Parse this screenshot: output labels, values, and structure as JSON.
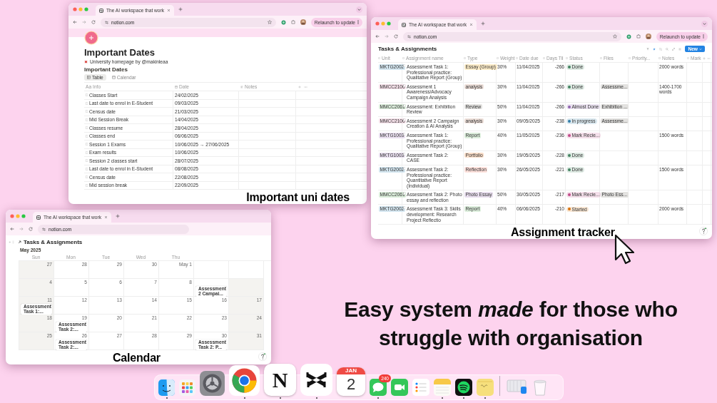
{
  "windows": [
    {
      "kind": "calendar",
      "tab_title": "The AI workspace that work",
      "url": "notion.com",
      "page_title": "Tasks & Assignments",
      "month": "May 2025",
      "weekdays": [
        "Sun",
        "Mon",
        "Tue",
        "Wed",
        "Thu"
      ],
      "weeks": [
        [
          {
            "number": "27",
            "shaded": true
          },
          {
            "number": "28",
            "shaded": false
          },
          {
            "number": "29",
            "shaded": false
          },
          {
            "number": "30",
            "shaded": false
          },
          {
            "number": "May 1",
            "shaded": false
          }
        ],
        [
          {
            "number": "4",
            "shaded": true
          },
          {
            "number": "5",
            "shaded": false
          },
          {
            "number": "6",
            "shaded": false
          },
          {
            "number": "7",
            "shaded": false
          },
          {
            "number": "8",
            "shaded": false
          },
          {
            "shaded": false,
            "events": [
              "Assessment 2 Campai..."
            ]
          },
          {
            "shaded": true
          }
        ],
        [
          {
            "number": "11",
            "shaded": true,
            "events": [
              "Assessment Task 1:..."
            ]
          },
          {
            "number": "12",
            "shaded": false
          },
          {
            "number": "13",
            "shaded": false
          },
          {
            "number": "14",
            "shaded": false
          },
          {
            "number": "15",
            "shaded": false
          },
          {
            "number": "16",
            "shaded": false
          },
          {
            "number": "17",
            "shaded": true
          }
        ],
        [
          {
            "number": "18",
            "shaded": true
          },
          {
            "number": "19",
            "shaded": false,
            "events": [
              "Assessment Task 2:..."
            ]
          },
          {
            "number": "20",
            "shaded": false
          },
          {
            "number": "21",
            "shaded": false
          },
          {
            "number": "22",
            "shaded": false
          },
          {
            "number": "23",
            "shaded": false
          },
          {
            "number": "24",
            "shaded": true
          }
        ],
        [
          {
            "number": "25",
            "shaded": true
          },
          {
            "number": "26",
            "shaded": false,
            "events": [
              "Assessment Task 2:..."
            ]
          },
          {
            "number": "27",
            "shaded": false
          },
          {
            "number": "28",
            "shaded": false
          },
          {
            "number": "29",
            "shaded": false
          },
          {
            "number": "30",
            "shaded": false,
            "events": [
              "Assessment Task 2: P..."
            ]
          },
          {
            "number": "31",
            "shaded": true
          }
        ]
      ],
      "caption": "Calendar"
    },
    {
      "kind": "table",
      "tab_title": "The AI workspace that work",
      "url": "notion.com",
      "relaunch": "Relaunch to update",
      "title": "Important Dates",
      "subtitle": "University homepage by @makinleaa",
      "database_title": "Important Dates",
      "views": [
        {
          "label": "Table",
          "selected": true
        },
        {
          "label": "Calendar",
          "selected": false
        }
      ],
      "columns": [
        {
          "glyph": "Aa",
          "label": "Info"
        },
        {
          "label": "Date"
        },
        {
          "label": "Notes"
        }
      ],
      "rows": [
        {
          "info": "Classes Start",
          "date": "24/02/2025"
        },
        {
          "info": "Last date to enrol in E-Student",
          "date": "09/03/2025"
        },
        {
          "info": "Census date",
          "date": "21/03/2025"
        },
        {
          "info": "Mid Session Break",
          "date": "14/04/2025"
        },
        {
          "info": "Classes resume",
          "date": "28/04/2025"
        },
        {
          "info": "Classes end",
          "date": "06/06/2025"
        },
        {
          "info": "Session 1 Exams",
          "date": "10/06/2025 → 27/06/2025"
        },
        {
          "info": "Exam results",
          "date": "10/06/2025"
        },
        {
          "info": "Session 2 classes start",
          "date": "28/07/2025"
        },
        {
          "info": "Last date to enrol in E-Student",
          "date": "08/08/2025"
        },
        {
          "info": "Census date",
          "date": "22/08/2025"
        },
        {
          "info": "Mid session break",
          "date": "22/09/2025"
        }
      ],
      "caption": "Important uni dates"
    },
    {
      "kind": "tracker",
      "tab_title": "The AI workspace that work",
      "url": "notion.com",
      "relaunch": "Relaunch to update",
      "title": "Tasks & Assignments",
      "new_button": "New",
      "columns": [
        "Unit",
        "Assignment name",
        "Type",
        "Weight",
        "Date due",
        "Days Til",
        "Status",
        "Files",
        "Priority...",
        "Notes",
        "Mark"
      ],
      "rows": [
        {
          "unit": {
            "text": "MKTG2002",
            "color": "#d3e5ef"
          },
          "name": "Assessment Task 1: Professional practice: Qualitative Report (Group)",
          "type": {
            "text": "Essay (Group)",
            "color": "#fdecc8"
          },
          "weight": "30%",
          "due": "11/04/2025",
          "days": "-266",
          "status": {
            "text": "Done",
            "color": "#448361"
          },
          "notes": "2000 words"
        },
        {
          "unit": {
            "text": "MMCC2100",
            "color": "#f5e0e9"
          },
          "name": "Assessment 1 Awareness/Advocacy Campaign Analysis",
          "type": {
            "text": "analysis",
            "color": "#eee0da"
          },
          "weight": "30%",
          "due": "11/04/2025",
          "days": "-266",
          "status": {
            "text": "Done",
            "color": "#448361"
          },
          "files": "Assessme...",
          "notes": "1400-1700 words"
        },
        {
          "unit": {
            "text": "MMCC2061",
            "color": "#dbeddb"
          },
          "name": "Assessment: Exhibition Review",
          "type": {
            "text": "Review",
            "color": "#e3e2e0"
          },
          "weight": "50%",
          "due": "11/04/2025",
          "days": "-266",
          "status": {
            "text": "Almost Done",
            "color": "#9065b0"
          },
          "files": "Exhibition ..."
        },
        {
          "unit": {
            "text": "MMCC2100",
            "color": "#f5e0e9"
          },
          "name": "Assessment 2 Campaign Creation & AI Analysis",
          "type": {
            "text": "analysis",
            "color": "#eee0da"
          },
          "weight": "30%",
          "due": "09/05/2025",
          "days": "-238",
          "status": {
            "text": "In progress",
            "color": "#337ea9"
          },
          "files": "Assessme..."
        },
        {
          "unit": {
            "text": "MKTG1003",
            "color": "#e8deee"
          },
          "name": "Assessment Task 1: Professional practice: Qualitative Report (Group)",
          "type": {
            "text": "Report",
            "color": "#dbeddb"
          },
          "weight": "40%",
          "due": "11/05/2025",
          "days": "-236",
          "status": {
            "text": "Mark Recie...",
            "color": "#c14c8a"
          },
          "notes": "1500 words"
        },
        {
          "unit": {
            "text": "MKTG1003",
            "color": "#e8deee"
          },
          "name": "Assessment Task 2: CASE",
          "type": {
            "text": "Portfolio",
            "color": "#fadec9"
          },
          "weight": "30%",
          "due": "19/05/2025",
          "days": "-228",
          "status": {
            "text": "Done",
            "color": "#448361"
          }
        },
        {
          "unit": {
            "text": "MKTG2002",
            "color": "#d3e5ef"
          },
          "name": "Assessment Task 2: Professional practice: Quantitative Report (Individual)",
          "type": {
            "text": "Reflection",
            "color": "#ffe2dd"
          },
          "weight": "30%",
          "due": "26/05/2025",
          "days": "-221",
          "status": {
            "text": "Done",
            "color": "#448361"
          },
          "notes": "1500 words"
        },
        {
          "unit": {
            "text": "MMCC2061",
            "color": "#dbeddb"
          },
          "name": "Assessment Task 2: Photo essay and reflection",
          "type": {
            "text": "Photo Essay",
            "color": "#e8deee"
          },
          "weight": "50%",
          "due": "30/05/2025",
          "days": "-217",
          "status": {
            "text": "Mark Recie...",
            "color": "#c14c8a"
          },
          "files": "Photo Ess..."
        },
        {
          "unit": {
            "text": "MKTG2002",
            "color": "#d3e5ef"
          },
          "name": "Assessment Task 3: Skills development: Research Project Reflectio",
          "type": {
            "text": "Report",
            "color": "#dbeddb"
          },
          "weight": "40%",
          "due": "06/06/2025",
          "days": "-210",
          "status": {
            "text": "Started",
            "color": "#d9730d"
          },
          "notes": "2000 words"
        }
      ],
      "caption": "Assignment tracker"
    }
  ],
  "headline": "Easy system *made* for those who struggle with organisation",
  "dock": [
    {
      "kind": "finder",
      "running": true
    },
    {
      "kind": "launchpad",
      "running": false
    },
    {
      "kind": "settings",
      "running": false
    },
    {
      "kind": "chrome",
      "running": true
    },
    {
      "kind": "notion",
      "glyph": "N",
      "running": true
    },
    {
      "kind": "capcut",
      "running": true
    },
    {
      "kind": "calendar",
      "month": "JAN",
      "day": "2",
      "running": false
    },
    {
      "kind": "messages",
      "badge": "240",
      "running": true
    },
    {
      "kind": "facetime",
      "running": false
    },
    {
      "kind": "reminders",
      "running": false
    },
    {
      "kind": "notes",
      "running": true
    },
    {
      "kind": "spotify",
      "running": true
    },
    {
      "kind": "stickies",
      "running": true
    },
    {
      "kind": "separator"
    },
    {
      "kind": "downloads",
      "running": false
    },
    {
      "kind": "trash",
      "running": false
    }
  ]
}
